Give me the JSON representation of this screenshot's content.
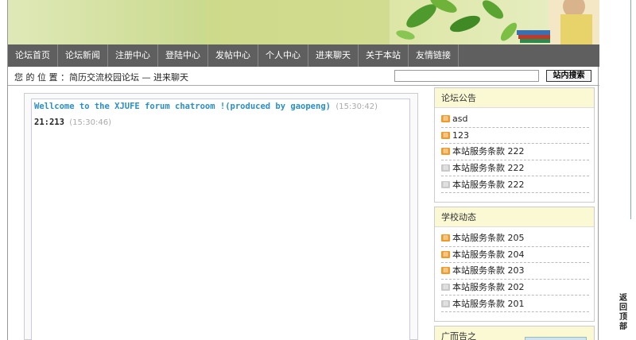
{
  "nav": [
    "论坛首页",
    "论坛新闻",
    "注册中心",
    "登陆中心",
    "发帖中心",
    "个人中心",
    "进来聊天",
    "关于本站",
    "友情链接"
  ],
  "breadcrumb": "您 的 位 置 ：简历交流校园论坛 — 进来聊天",
  "search": {
    "value": "",
    "button": "站内搜索"
  },
  "chat": {
    "messages": [
      {
        "text": "Wellcome to the XJUFE forum chatroom !(produced by gaopeng)",
        "time": "(15:30:42)"
      },
      {
        "text": "21:213",
        "time": "(15:30:46)"
      }
    ]
  },
  "announcements": {
    "title": "论坛公告",
    "items": [
      {
        "badge": "hot",
        "label": "asd"
      },
      {
        "badge": "hot",
        "label": "123"
      },
      {
        "badge": "hot",
        "label": "本站服务条款  222"
      },
      {
        "badge": "grey",
        "label": "本站服务条款  222"
      },
      {
        "badge": "grey",
        "label": "本站服务条款  222"
      }
    ]
  },
  "school_news": {
    "title": "学校动态",
    "items": [
      {
        "badge": "hot",
        "label": "本站服务条款  205"
      },
      {
        "badge": "hot",
        "label": "本站服务条款  204"
      },
      {
        "badge": "hot",
        "label": "本站服务条款  203"
      },
      {
        "badge": "grey",
        "label": "本站服务条款  202"
      },
      {
        "badge": "grey",
        "label": "本站服务条款  201"
      }
    ]
  },
  "ads": {
    "title": "广而告之"
  },
  "back_to_top": "返回顶部",
  "colors": {
    "nav_bg": "#5f5f5f",
    "chat_accent": "#2a8fc7",
    "panel_head": "#fbf8d4",
    "badge_hot": "#f09a2a"
  },
  "icons": [
    "leaf-decoration",
    "person-reading-banner",
    "new-badge-icon"
  ]
}
